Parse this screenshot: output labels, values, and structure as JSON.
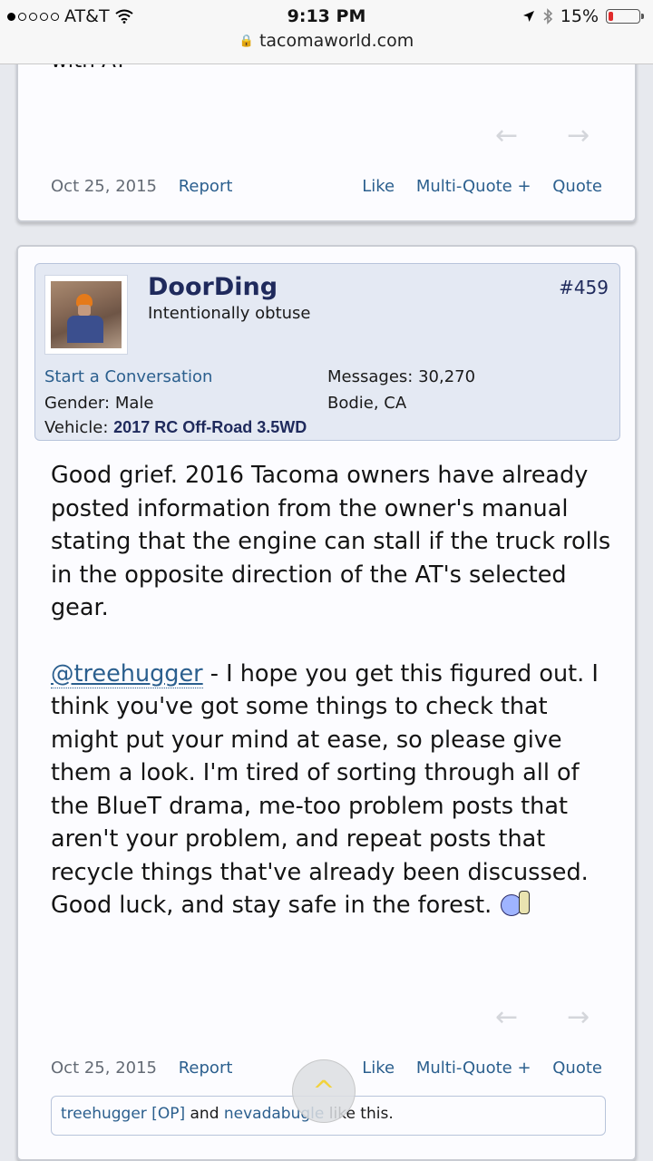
{
  "status": {
    "carrier": "AT&T",
    "time": "9:13 PM",
    "battery": "15%",
    "battery_level": 0.15,
    "url": "tacomaworld.com"
  },
  "prev_post": {
    "partial_text": "with AT",
    "date": "Oct 25, 2015",
    "report": "Report",
    "like": "Like",
    "multiquote": "Multi-Quote +",
    "quote": "Quote"
  },
  "post": {
    "username": "DoorDing",
    "user_title": "Intentionally obtuse",
    "post_number": "#459",
    "start_conversation": "Start a Conversation",
    "gender_label": "Gender:",
    "gender": "Male",
    "vehicle_label": "Vehicle:",
    "vehicle": "2017 RC Off-Road 3.5WD",
    "messages_label": "Messages:",
    "messages": "30,270",
    "location": "Bodie, CA",
    "paragraph1": "Good grief. 2016 Tacoma owners have already posted information from the owner's manual stating that the engine can stall if the truck rolls in the opposite direction of the AT's selected gear.",
    "mention": "@treehugger",
    "paragraph2": " - I hope you get this figured out. I think you've got some things to check that might put your mind at ease, so please give them a look. I'm tired of sorting through all of the BlueT drama, me-too problem posts that aren't your problem, and repeat posts that recycle things that've already been discussed. Good luck, and stay safe in the forest.",
    "date": "Oct 25, 2015",
    "report": "Report",
    "like": "Like",
    "multiquote": "Multi-Quote +",
    "quote": "Quote",
    "likes": {
      "user1": "treehugger [OP]",
      "and": " and ",
      "user2": "nevadabugle",
      "suffix": " like this."
    }
  },
  "icons": {
    "arrow_left": "←",
    "arrow_right": "→",
    "scroll_up": "^"
  }
}
